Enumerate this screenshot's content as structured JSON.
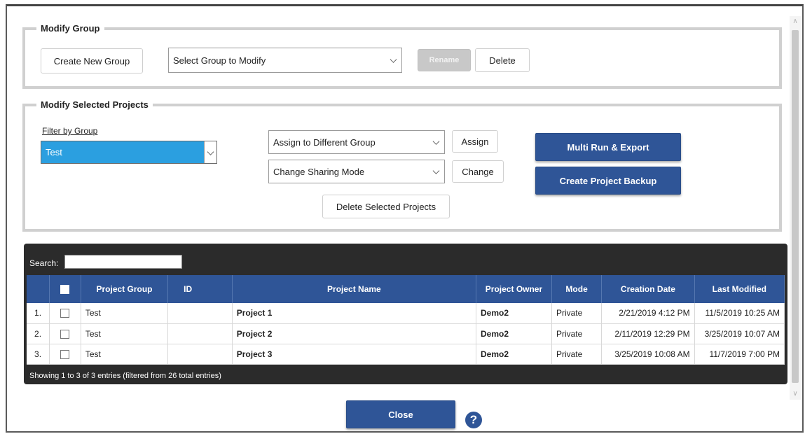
{
  "modify_group": {
    "legend": "Modify Group",
    "create_new_group": "Create New Group",
    "select_group_placeholder": "Select Group to Modify",
    "rename": "Rename",
    "delete": "Delete"
  },
  "modify_projects": {
    "legend": "Modify Selected Projects",
    "filter_label": "Filter by Group",
    "filter_value": "Test",
    "assign_select": "Assign to Different Group",
    "assign_button": "Assign",
    "sharing_select": "Change Sharing Mode",
    "change_button": "Change",
    "delete_selected": "Delete Selected Projects",
    "multi_run": "Multi Run & Export",
    "create_backup": "Create Project Backup"
  },
  "table": {
    "search_label": "Search:",
    "search_value": "",
    "columns": [
      "",
      "",
      "Project Group",
      "ID",
      "Project Name",
      "Project Owner",
      "Mode",
      "Creation Date",
      "Last Modified"
    ],
    "rows": [
      {
        "num": "1.",
        "group": "Test",
        "id": "",
        "name": "Project 1",
        "owner": "Demo2",
        "mode": "Private",
        "created": "2/21/2019 4:12 PM",
        "modified": "11/5/2019 10:25 AM"
      },
      {
        "num": "2.",
        "group": "Test",
        "id": "",
        "name": "Project 2",
        "owner": "Demo2",
        "mode": "Private",
        "created": "2/11/2019 12:29 PM",
        "modified": "3/25/2019 10:07 AM"
      },
      {
        "num": "3.",
        "group": "Test",
        "id": "",
        "name": "Project 3",
        "owner": "Demo2",
        "mode": "Private",
        "created": "3/25/2019 10:08 AM",
        "modified": "11/7/2019 7:00 PM"
      }
    ],
    "footer": "Showing 1 to 3 of 3 entries (filtered from 26 total entries)"
  },
  "close": "Close",
  "help": "?",
  "colors": {
    "primary": "#2f5597",
    "highlight": "#2b9fe0",
    "table_bg": "#2b2b2b"
  },
  "icons": {
    "help": "question-circle-icon",
    "chevron": "chevron-down-icon"
  }
}
